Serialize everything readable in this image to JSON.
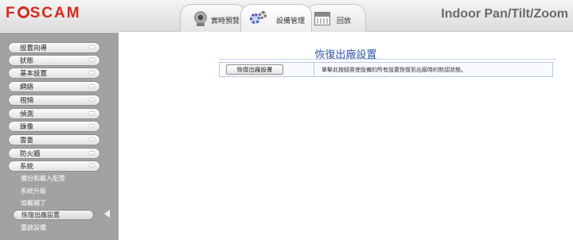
{
  "header": {
    "logo_text": "FOSCAM",
    "product_name": "Indoor Pan/Tilt/Zoom",
    "tabs": [
      {
        "label": "實時預覽",
        "icon": "camera-icon"
      },
      {
        "label": "設備管理",
        "icon": "gears-icon"
      },
      {
        "label": "回放",
        "icon": "calendar-icon"
      }
    ]
  },
  "sidebar": {
    "menu": [
      {
        "label": "設置向導"
      },
      {
        "label": "狀態"
      },
      {
        "label": "基本設置"
      },
      {
        "label": "網絡"
      },
      {
        "label": "視頻"
      },
      {
        "label": "偵測"
      },
      {
        "label": "錄像"
      },
      {
        "label": "雲臺"
      },
      {
        "label": "防火牆"
      },
      {
        "label": "系統"
      }
    ],
    "submenu": [
      {
        "label": "備份和載入配置"
      },
      {
        "label": "系統升級"
      },
      {
        "label": "加載補丁"
      },
      {
        "label": "恢復出廠設置"
      },
      {
        "label": "重啟設備"
      }
    ]
  },
  "main": {
    "title": "恢復出廠設置",
    "restore_button": "恢復出廠設置",
    "description": "單擊此按鈕將使設備的所有設置恢復到出廠時的默認狀態。"
  },
  "colors": {
    "logo": "#d62a1e",
    "sidebar_bg": "#a2a2a2",
    "title": "#3355aa"
  }
}
